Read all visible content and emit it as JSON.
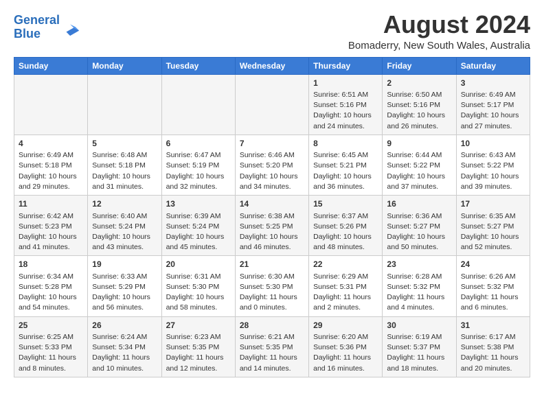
{
  "header": {
    "logo_line1": "General",
    "logo_line2": "Blue",
    "month_title": "August 2024",
    "location": "Bomaderry, New South Wales, Australia"
  },
  "days_of_week": [
    "Sunday",
    "Monday",
    "Tuesday",
    "Wednesday",
    "Thursday",
    "Friday",
    "Saturday"
  ],
  "weeks": [
    [
      {
        "day": "",
        "content": ""
      },
      {
        "day": "",
        "content": ""
      },
      {
        "day": "",
        "content": ""
      },
      {
        "day": "",
        "content": ""
      },
      {
        "day": "1",
        "content": "Sunrise: 6:51 AM\nSunset: 5:16 PM\nDaylight: 10 hours\nand 24 minutes."
      },
      {
        "day": "2",
        "content": "Sunrise: 6:50 AM\nSunset: 5:16 PM\nDaylight: 10 hours\nand 26 minutes."
      },
      {
        "day": "3",
        "content": "Sunrise: 6:49 AM\nSunset: 5:17 PM\nDaylight: 10 hours\nand 27 minutes."
      }
    ],
    [
      {
        "day": "4",
        "content": "Sunrise: 6:49 AM\nSunset: 5:18 PM\nDaylight: 10 hours\nand 29 minutes."
      },
      {
        "day": "5",
        "content": "Sunrise: 6:48 AM\nSunset: 5:18 PM\nDaylight: 10 hours\nand 31 minutes."
      },
      {
        "day": "6",
        "content": "Sunrise: 6:47 AM\nSunset: 5:19 PM\nDaylight: 10 hours\nand 32 minutes."
      },
      {
        "day": "7",
        "content": "Sunrise: 6:46 AM\nSunset: 5:20 PM\nDaylight: 10 hours\nand 34 minutes."
      },
      {
        "day": "8",
        "content": "Sunrise: 6:45 AM\nSunset: 5:21 PM\nDaylight: 10 hours\nand 36 minutes."
      },
      {
        "day": "9",
        "content": "Sunrise: 6:44 AM\nSunset: 5:22 PM\nDaylight: 10 hours\nand 37 minutes."
      },
      {
        "day": "10",
        "content": "Sunrise: 6:43 AM\nSunset: 5:22 PM\nDaylight: 10 hours\nand 39 minutes."
      }
    ],
    [
      {
        "day": "11",
        "content": "Sunrise: 6:42 AM\nSunset: 5:23 PM\nDaylight: 10 hours\nand 41 minutes."
      },
      {
        "day": "12",
        "content": "Sunrise: 6:40 AM\nSunset: 5:24 PM\nDaylight: 10 hours\nand 43 minutes."
      },
      {
        "day": "13",
        "content": "Sunrise: 6:39 AM\nSunset: 5:24 PM\nDaylight: 10 hours\nand 45 minutes."
      },
      {
        "day": "14",
        "content": "Sunrise: 6:38 AM\nSunset: 5:25 PM\nDaylight: 10 hours\nand 46 minutes."
      },
      {
        "day": "15",
        "content": "Sunrise: 6:37 AM\nSunset: 5:26 PM\nDaylight: 10 hours\nand 48 minutes."
      },
      {
        "day": "16",
        "content": "Sunrise: 6:36 AM\nSunset: 5:27 PM\nDaylight: 10 hours\nand 50 minutes."
      },
      {
        "day": "17",
        "content": "Sunrise: 6:35 AM\nSunset: 5:27 PM\nDaylight: 10 hours\nand 52 minutes."
      }
    ],
    [
      {
        "day": "18",
        "content": "Sunrise: 6:34 AM\nSunset: 5:28 PM\nDaylight: 10 hours\nand 54 minutes."
      },
      {
        "day": "19",
        "content": "Sunrise: 6:33 AM\nSunset: 5:29 PM\nDaylight: 10 hours\nand 56 minutes."
      },
      {
        "day": "20",
        "content": "Sunrise: 6:31 AM\nSunset: 5:30 PM\nDaylight: 10 hours\nand 58 minutes."
      },
      {
        "day": "21",
        "content": "Sunrise: 6:30 AM\nSunset: 5:30 PM\nDaylight: 11 hours\nand 0 minutes."
      },
      {
        "day": "22",
        "content": "Sunrise: 6:29 AM\nSunset: 5:31 PM\nDaylight: 11 hours\nand 2 minutes."
      },
      {
        "day": "23",
        "content": "Sunrise: 6:28 AM\nSunset: 5:32 PM\nDaylight: 11 hours\nand 4 minutes."
      },
      {
        "day": "24",
        "content": "Sunrise: 6:26 AM\nSunset: 5:32 PM\nDaylight: 11 hours\nand 6 minutes."
      }
    ],
    [
      {
        "day": "25",
        "content": "Sunrise: 6:25 AM\nSunset: 5:33 PM\nDaylight: 11 hours\nand 8 minutes."
      },
      {
        "day": "26",
        "content": "Sunrise: 6:24 AM\nSunset: 5:34 PM\nDaylight: 11 hours\nand 10 minutes."
      },
      {
        "day": "27",
        "content": "Sunrise: 6:23 AM\nSunset: 5:35 PM\nDaylight: 11 hours\nand 12 minutes."
      },
      {
        "day": "28",
        "content": "Sunrise: 6:21 AM\nSunset: 5:35 PM\nDaylight: 11 hours\nand 14 minutes."
      },
      {
        "day": "29",
        "content": "Sunrise: 6:20 AM\nSunset: 5:36 PM\nDaylight: 11 hours\nand 16 minutes."
      },
      {
        "day": "30",
        "content": "Sunrise: 6:19 AM\nSunset: 5:37 PM\nDaylight: 11 hours\nand 18 minutes."
      },
      {
        "day": "31",
        "content": "Sunrise: 6:17 AM\nSunset: 5:38 PM\nDaylight: 11 hours\nand 20 minutes."
      }
    ]
  ]
}
